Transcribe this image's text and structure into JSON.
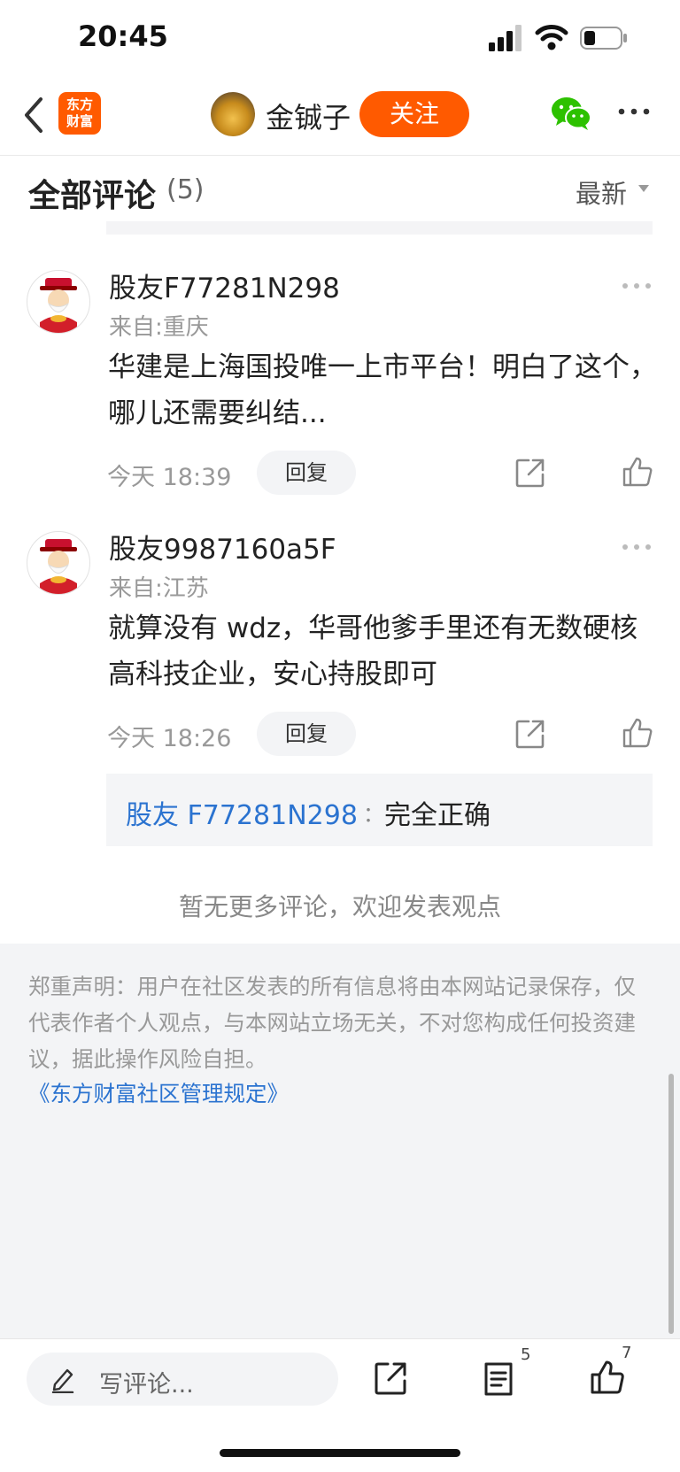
{
  "status_bar": {
    "time": "20:45"
  },
  "nav": {
    "logo_line1": "东方",
    "logo_line2": "财富",
    "nickname": "金铖子",
    "follow_label": "关注"
  },
  "comments_header": {
    "title": "全部评论",
    "count": "(5)",
    "sort_label": "最新"
  },
  "comments": [
    {
      "user": "股友F77281N298",
      "location": "来自:重庆",
      "text": "华建是上海国投唯一上市平台！明白了这个，哪儿还需要纠结...",
      "time": "今天 18:39",
      "reply_label": "回复"
    },
    {
      "user": "股友9987160a5F",
      "location": "来自:江苏",
      "text": "就算没有 wdz，华哥他爹手里还有无数硬核高科技企业，安心持股即可",
      "time": "今天 18:26",
      "reply_label": "回复",
      "sub_reply": {
        "user": "股友 F77281N298",
        "colon": "：",
        "text": "完全正确"
      }
    }
  ],
  "no_more_text": "暂无更多评论，欢迎发表观点",
  "footer": {
    "disclaimer": "郑重声明：用户在社区发表的所有信息将由本网站记录保存，仅代表作者个人观点，与本网站立场无关，不对您构成任何投资建议，据此操作风险自担。",
    "rules_link": "《东方财富社区管理规定》"
  },
  "bottom_bar": {
    "composer_placeholder": "写评论...",
    "comment_count": "5",
    "like_count": "7"
  },
  "colors": {
    "brand_orange": "#ff5a00",
    "link_blue": "#2b73d0",
    "wechat_green": "#2dc100"
  },
  "icons": [
    "chevron-left-icon",
    "wechat-icon",
    "more-icon",
    "share-icon",
    "like-icon",
    "pencil-icon",
    "comment-list-icon"
  ]
}
